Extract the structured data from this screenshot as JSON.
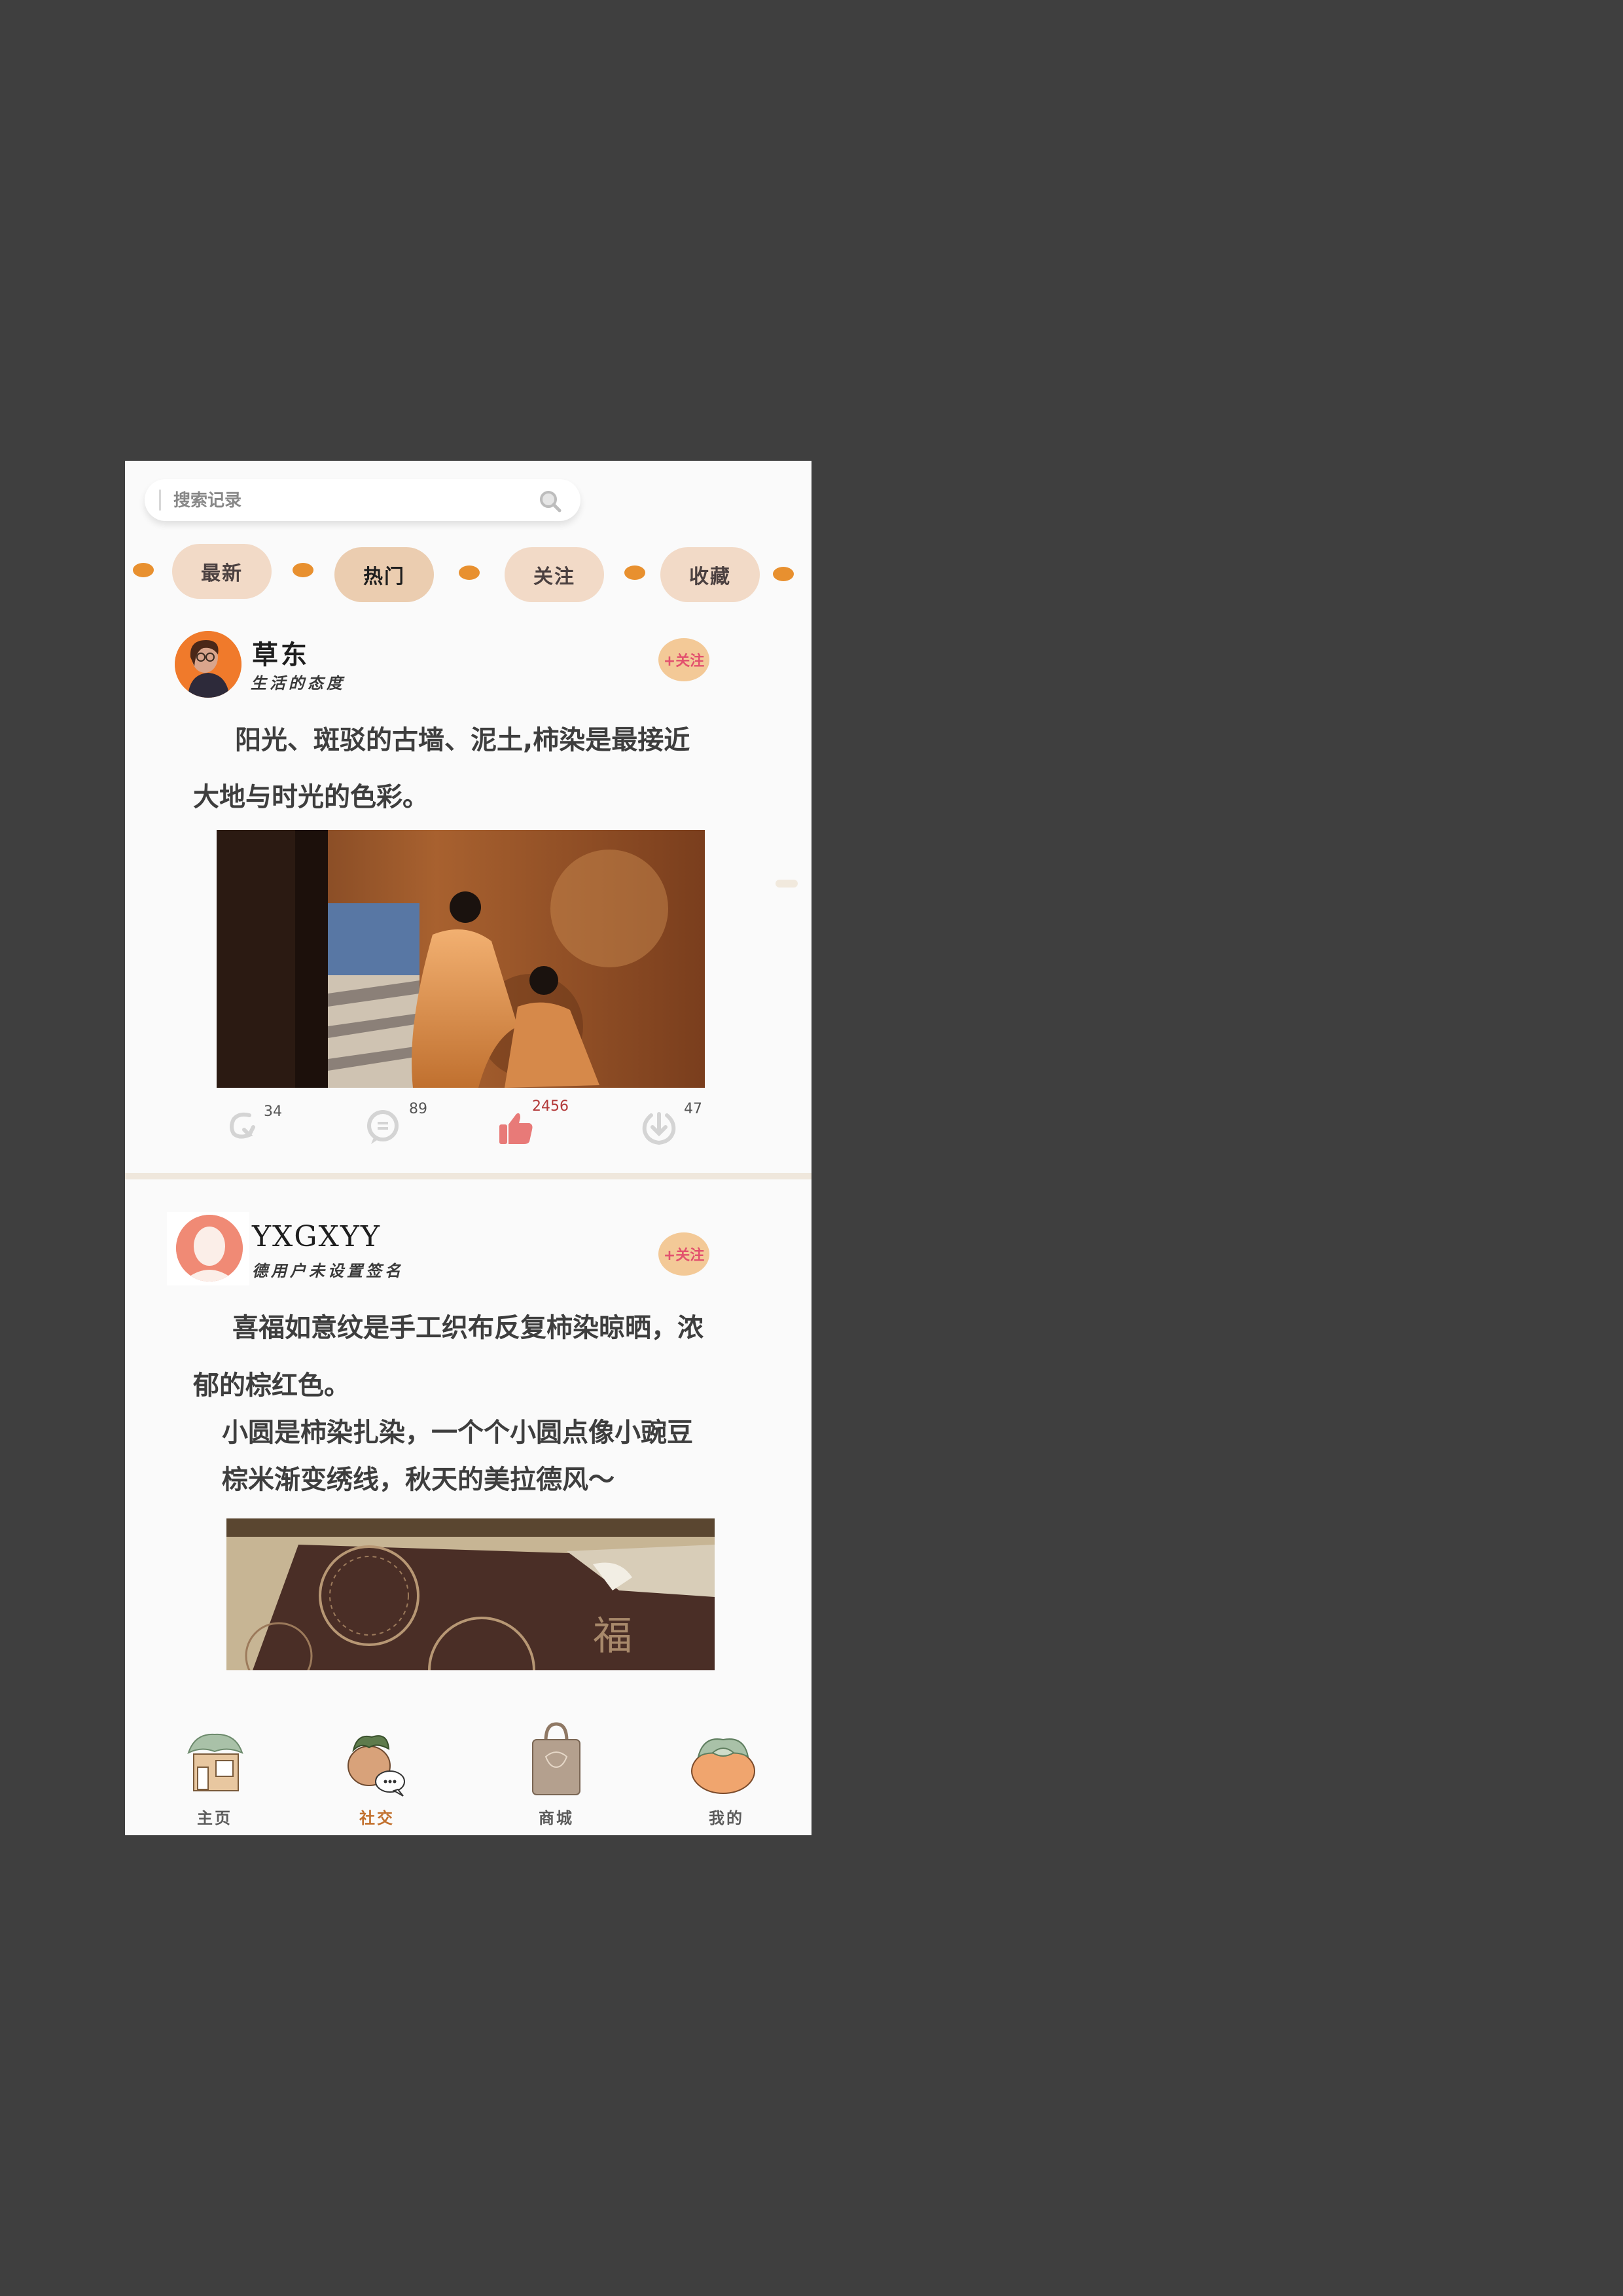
{
  "search": {
    "placeholder": "搜索记录"
  },
  "tabs": [
    {
      "label": "最新",
      "active": false
    },
    {
      "label": "热门",
      "active": true
    },
    {
      "label": "关注",
      "active": false
    },
    {
      "label": "收藏",
      "active": false
    }
  ],
  "posts": [
    {
      "username": "草东",
      "signature": "生活的态度",
      "follow_label": "+关注",
      "text_lines": [
        "阳光、斑驳的古墙、泥土,柿染是最接近",
        "大地与时光的色彩。"
      ],
      "actions": {
        "share": "34",
        "comment": "89",
        "like": "2456",
        "download": "47"
      }
    },
    {
      "username": "YXGXYY",
      "signature": "德用户未设置签名",
      "follow_label": "+关注",
      "text_lines": [
        "喜福如意纹是手工织布反复柿染晾晒，浓",
        "郁的棕红色。",
        "小圆是柿染扎染，一个个小圆点像小豌豆",
        "棕米渐变绣线，秋天的美拉德风～"
      ]
    }
  ],
  "nav": [
    {
      "label": "主页",
      "icon": "home-persimmon-icon",
      "active": false
    },
    {
      "label": "社交",
      "icon": "social-chat-icon",
      "active": true
    },
    {
      "label": "商城",
      "icon": "shopping-bag-icon",
      "active": false
    },
    {
      "label": "我的",
      "icon": "persimmon-profile-icon",
      "active": false
    }
  ],
  "colors": {
    "accent": "#e8902f",
    "tab_bg": "#f2dac7",
    "like": "#e87a78",
    "like_count": "#b33a3a",
    "follow_text": "#e2516e"
  }
}
